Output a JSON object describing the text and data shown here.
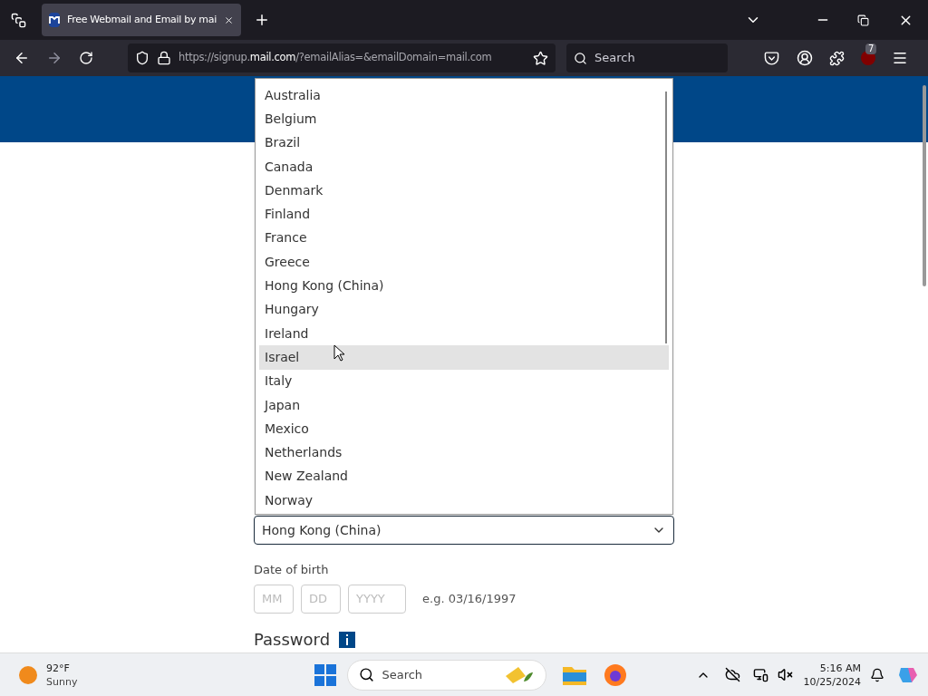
{
  "browser": {
    "tab": {
      "title": "Free Webmail and Email by mai"
    },
    "url": "https://signup.**mail.com**/?emailAlias=&emailDomain=mail.com",
    "search": {
      "placeholder": "Search"
    },
    "extension_badge": "7"
  },
  "form": {
    "country_options": [
      {
        "label": "Australia",
        "selected": false
      },
      {
        "label": "Belgium",
        "selected": false
      },
      {
        "label": "Brazil",
        "selected": false
      },
      {
        "label": "Canada",
        "selected": false
      },
      {
        "label": "Denmark",
        "selected": false
      },
      {
        "label": "Finland",
        "selected": false
      },
      {
        "label": "France",
        "selected": false
      },
      {
        "label": "Greece",
        "selected": false
      },
      {
        "label": "Hong Kong (China)",
        "selected": false
      },
      {
        "label": "Hungary",
        "selected": false
      },
      {
        "label": "Ireland",
        "selected": false
      },
      {
        "label": "Israel",
        "selected": true
      },
      {
        "label": "Italy",
        "selected": false
      },
      {
        "label": "Japan",
        "selected": false
      },
      {
        "label": "Mexico",
        "selected": false
      },
      {
        "label": "Netherlands",
        "selected": false
      },
      {
        "label": "New Zealand",
        "selected": false
      },
      {
        "label": "Norway",
        "selected": false
      }
    ],
    "country": {
      "value": "Hong Kong (China)"
    },
    "dob": {
      "label": "Date of birth",
      "fields": [
        {
          "placeholder": "MM"
        },
        {
          "placeholder": "DD"
        },
        {
          "placeholder": "YYYY"
        }
      ],
      "example": "e.g. 03/16/1997"
    },
    "password_heading": "Password"
  },
  "taskbar": {
    "weather": {
      "temp": "92°F",
      "condition": "Sunny"
    },
    "search": {
      "placeholder": "Search"
    },
    "time": "5:16 AM",
    "date": "10/25/2024"
  }
}
